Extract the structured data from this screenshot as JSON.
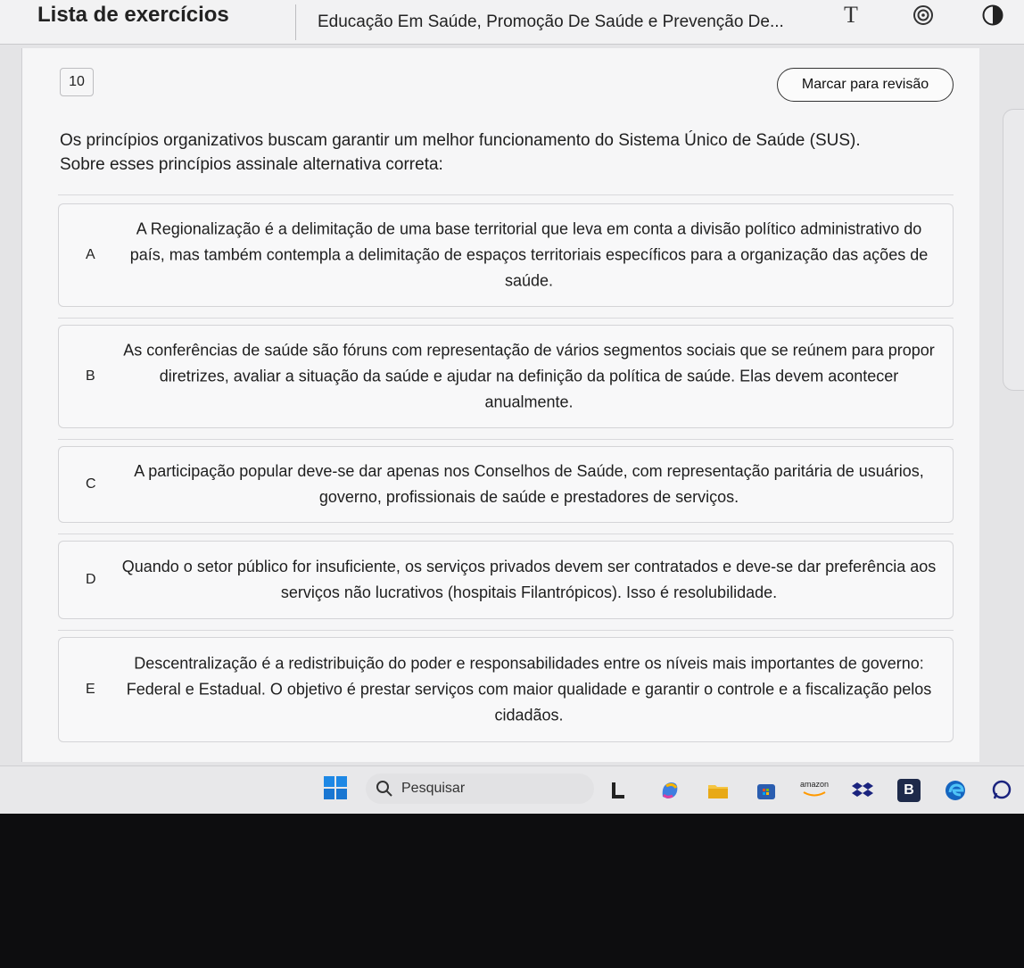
{
  "header": {
    "app_title": "Lista de exercícios",
    "course_title": "Educação Em Saúde, Promoção De Saúde e Prevenção De...",
    "font_icon_glyph": "T"
  },
  "question": {
    "number": "10",
    "review_label": "Marcar para revisão",
    "statement_line1": "Os princípios organizativos buscam garantir um melhor funcionamento do Sistema Único de Saúde (SUS).",
    "statement_line2": "Sobre esses princípios assinale alternativa correta:"
  },
  "options": [
    {
      "letter": "A",
      "text": "A Regionalização é a delimitação de uma base territorial que leva em conta a divisão político administrativo do país, mas também contempla a delimitação de espaços territoriais específicos para a organização das ações de saúde."
    },
    {
      "letter": "B",
      "text": "As conferências de saúde são fóruns com representação de vários segmentos sociais que se reúnem para propor diretrizes, avaliar a situação da saúde e ajudar na definição da política de saúde. Elas devem acontecer anualmente."
    },
    {
      "letter": "C",
      "text": "A participação popular deve-se dar apenas nos Conselhos de Saúde, com representação paritária de usuários, governo, profissionais de saúde e prestadores de serviços."
    },
    {
      "letter": "D",
      "text": "Quando o setor público for insuficiente, os serviços privados devem ser contratados e deve-se dar preferência aos serviços não lucrativos (hospitais Filantrópicos). Isso é resolubilidade."
    },
    {
      "letter": "E",
      "text": "Descentralização é a redistribuição do poder e responsabilidades entre os níveis mais importantes de governo: Federal e Estadual. O objetivo é prestar serviços com maior qualidade e garantir o controle e a fiscalização pelos cidadãos."
    }
  ],
  "taskbar": {
    "search_label": "Pesquisar",
    "amazon_label": "amazon",
    "bing_label": "B"
  },
  "colors": {
    "windows_blue": "#1e88e5",
    "edge_blue": "#1565c0",
    "dropbox_blue": "#1a237e"
  }
}
